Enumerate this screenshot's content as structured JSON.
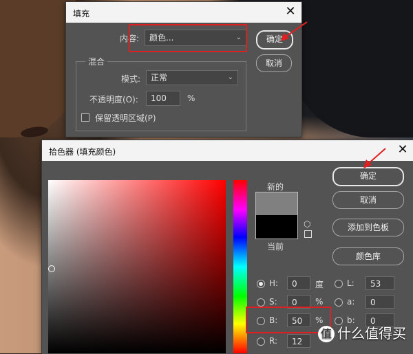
{
  "fill_dialog": {
    "title": "填充",
    "content_label": "内容:",
    "content_value": "颜色...",
    "ok_label": "确定",
    "cancel_label": "取消",
    "blend_group_label": "混合",
    "mode_label": "模式:",
    "mode_value": "正常",
    "opacity_label": "不透明度(O):",
    "opacity_value": "100",
    "opacity_unit": "%",
    "preserve_label": "保留透明区域(P)"
  },
  "picker_dialog": {
    "title": "拾色器 (填充颜色)",
    "ok_label": "确定",
    "cancel_label": "取消",
    "add_swatch_label": "添加到色板",
    "color_libraries_label": "颜色库",
    "new_label": "新的",
    "current_label": "当前",
    "fields": {
      "H": {
        "label": "H:",
        "value": "0",
        "unit": "度"
      },
      "S": {
        "label": "S:",
        "value": "0",
        "unit": "%"
      },
      "B": {
        "label": "B:",
        "value": "50",
        "unit": "%"
      },
      "R": {
        "label": "R:",
        "value": "12"
      },
      "L": {
        "label": "L:",
        "value": "53"
      },
      "a": {
        "label": "a:",
        "value": "0"
      },
      "b": {
        "label": "b:",
        "value": "0"
      }
    },
    "colors": {
      "new": "#808080",
      "current": "#000000"
    }
  },
  "watermark": {
    "text": "什么值得买",
    "badge": "值"
  },
  "annotation_color": "#e02020"
}
